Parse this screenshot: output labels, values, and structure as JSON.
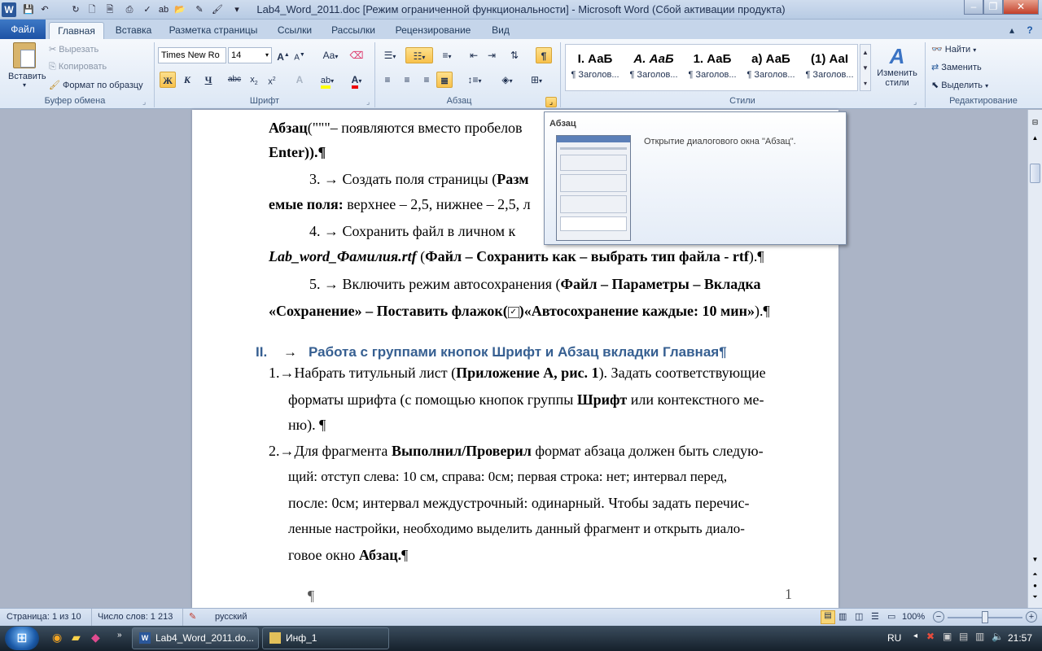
{
  "window": {
    "title": "Lab4_Word_2011.doc [Режим ограниченной функциональности]  -  Microsoft Word (Сбой активации продукта)"
  },
  "tabs": [
    "Файл",
    "Главная",
    "Вставка",
    "Разметка страницы",
    "Ссылки",
    "Рассылки",
    "Рецензирование",
    "Вид"
  ],
  "clipboard": {
    "paste": "Вставить",
    "cut": "Вырезать",
    "copy": "Копировать",
    "format_painter": "Формат по образцу",
    "label": "Буфер обмена"
  },
  "font": {
    "name": "Times New Ro",
    "size": "14",
    "bold": "Ж",
    "italic": "К",
    "underline": "Ч",
    "strike": "abc",
    "change_case": "Aa",
    "label": "Шрифт"
  },
  "paragraph": {
    "label": "Абзац"
  },
  "styles": {
    "items": [
      {
        "preview": "I. АаБ",
        "name": "¶ Заголов..."
      },
      {
        "preview": "А. АаБ",
        "name": "¶ Заголов..."
      },
      {
        "preview": "1. АаБ",
        "name": "¶ Заголов..."
      },
      {
        "preview": "а) АаБ",
        "name": "¶ Заголов..."
      },
      {
        "preview": "(1) АаІ",
        "name": "¶ Заголов..."
      }
    ],
    "change_styles": "Изменить стили",
    "label": "Стили"
  },
  "editing": {
    "find": "Найти",
    "replace": "Заменить",
    "select": "Выделить",
    "label": "Редактирование"
  },
  "tooltip": {
    "title": "Абзац",
    "text": "Открытие диалогового окна \"Абзац\"."
  },
  "document": {
    "l1a": "Абзац",
    "l1b": "(\"\"\"– появляются вместо пробелов",
    "l2": "Enter)).¶",
    "l3a": "3. →  Создать поля страницы (",
    "l3b": "Разм",
    "l4a": "емые поля:",
    "l4b": " верхнее – 2,5, нижнее – 2,5, л",
    "l5": "4. →  Сохранить  файл  в  личном  к",
    "l6a": "Lab_word_Фамилия.rtf",
    "l6b": " (",
    "l6c": "Файл – Сохранить как – выбрать тип файла - rtf",
    "l6d": ").¶",
    "l7a": "5. →  Включить режим автосохранения (",
    "l7b": "Файл – Параметры – Вкладка",
    "l8a": "«Сохранение» – Поставить флажок(",
    "l8b": ")«Автосохранение каждые: 10 мин»",
    "l8c": ").¶",
    "heading_num": "II.",
    "heading": "Работа с группами кнопок Шрифт и Абзац вкладки Главная¶",
    "p1a": "1.→Набрать титульный лист (",
    "p1b": "Приложение А, рис. 1",
    "p1c": "). Задать соответствующие",
    "p1d": "форматы шрифта (с помощью кнопок группы ",
    "p1e": "Шрифт",
    "p1f": " или контекстного ме-",
    "p1g": "ню). ¶",
    "p2a": "2.→Для фрагмента ",
    "p2b": "Выполнил/Проверил",
    "p2c": " формат абзаца должен быть следую-",
    "p2d": "щий: отступ слева: 10 см, справа: 0см; первая строка: нет; интервал перед,",
    "p2e": "после: 0см; интервал междустрочный: одинарный. Чтобы задать перечис-",
    "p2f": "ленные настройки, необходимо выделить данный фрагмент и открыть диало-",
    "p2g": "говое окно ",
    "p2h": "Абзац.",
    "p2i": "¶",
    "last_para": "¶",
    "page_num": "1"
  },
  "status": {
    "page": "Страница: 1 из 10",
    "words": "Число слов: 1 213",
    "lang": "русский",
    "zoom": "100%"
  },
  "taskbar": {
    "task1": "Lab4_Word_2011.do...",
    "task2": "Инф_1",
    "lang": "RU",
    "time": "21:57"
  }
}
